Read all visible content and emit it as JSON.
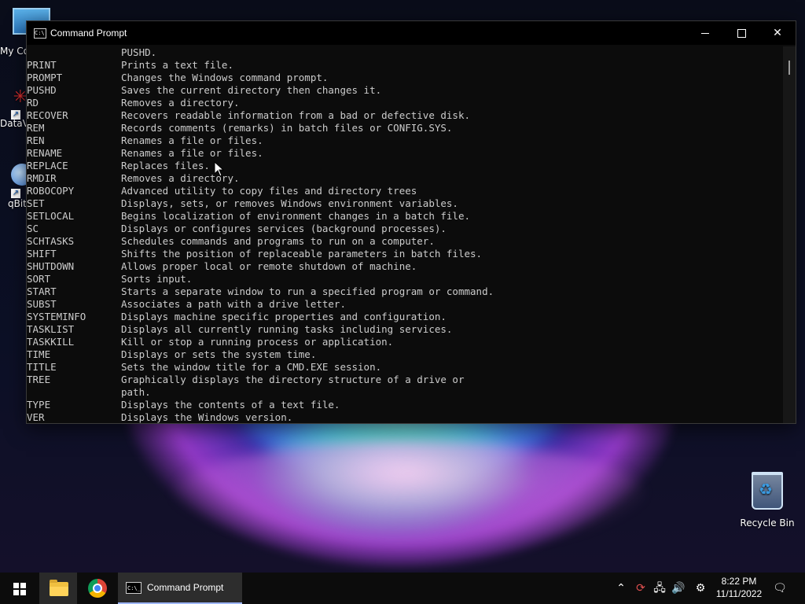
{
  "desktop": {
    "icons": [
      {
        "label": "My Co"
      },
      {
        "label": "DataV"
      },
      {
        "label": "qBitt"
      },
      {
        "label": "Recycle Bin"
      }
    ]
  },
  "window": {
    "title": "Command Prompt",
    "controls": {
      "minimize": "minimize-icon",
      "maximize": "maximize-icon",
      "close": "close-icon"
    }
  },
  "console": {
    "first_line": "PUSHD.",
    "commands": [
      {
        "name": "PRINT",
        "desc": "Prints a text file."
      },
      {
        "name": "PROMPT",
        "desc": "Changes the Windows command prompt."
      },
      {
        "name": "PUSHD",
        "desc": "Saves the current directory then changes it."
      },
      {
        "name": "RD",
        "desc": "Removes a directory."
      },
      {
        "name": "RECOVER",
        "desc": "Recovers readable information from a bad or defective disk."
      },
      {
        "name": "REM",
        "desc": "Records comments (remarks) in batch files or CONFIG.SYS."
      },
      {
        "name": "REN",
        "desc": "Renames a file or files."
      },
      {
        "name": "RENAME",
        "desc": "Renames a file or files."
      },
      {
        "name": "REPLACE",
        "desc": "Replaces files."
      },
      {
        "name": "RMDIR",
        "desc": "Removes a directory."
      },
      {
        "name": "ROBOCOPY",
        "desc": "Advanced utility to copy files and directory trees"
      },
      {
        "name": "SET",
        "desc": "Displays, sets, or removes Windows environment variables."
      },
      {
        "name": "SETLOCAL",
        "desc": "Begins localization of environment changes in a batch file."
      },
      {
        "name": "SC",
        "desc": "Displays or configures services (background processes)."
      },
      {
        "name": "SCHTASKS",
        "desc": "Schedules commands and programs to run on a computer."
      },
      {
        "name": "SHIFT",
        "desc": "Shifts the position of replaceable parameters in batch files."
      },
      {
        "name": "SHUTDOWN",
        "desc": "Allows proper local or remote shutdown of machine."
      },
      {
        "name": "SORT",
        "desc": "Sorts input."
      },
      {
        "name": "START",
        "desc": "Starts a separate window to run a specified program or command."
      },
      {
        "name": "SUBST",
        "desc": "Associates a path with a drive letter."
      },
      {
        "name": "SYSTEMINFO",
        "desc": "Displays machine specific properties and configuration."
      },
      {
        "name": "TASKLIST",
        "desc": "Displays all currently running tasks including services."
      },
      {
        "name": "TASKKILL",
        "desc": "Kill or stop a running process or application."
      },
      {
        "name": "TIME",
        "desc": "Displays or sets the system time."
      },
      {
        "name": "TITLE",
        "desc": "Sets the window title for a CMD.EXE session."
      },
      {
        "name": "TREE",
        "desc": "Graphically displays the directory structure of a drive or"
      },
      {
        "name": "",
        "desc": "path."
      },
      {
        "name": "TYPE",
        "desc": "Displays the contents of a text file."
      },
      {
        "name": "VER",
        "desc": "Displays the Windows version."
      }
    ]
  },
  "taskbar": {
    "apps": [
      {
        "name": "start",
        "icon": "windows-start-icon"
      },
      {
        "name": "file-explorer",
        "icon": "folder-icon"
      },
      {
        "name": "chrome",
        "icon": "chrome-icon"
      },
      {
        "name": "command-prompt",
        "label": "Command Prompt",
        "icon": "cmd-icon"
      }
    ],
    "tray": {
      "chevron": "⌃",
      "sync": "⟳",
      "network": "🖧",
      "volume": "🔊",
      "settings": "⚙",
      "notifications": "🗨"
    },
    "clock": {
      "time": "8:22 PM",
      "date": "11/11/2022"
    }
  },
  "colors": {
    "console_bg": "#0c0c0c",
    "console_text": "#cccccc",
    "taskbar_bg": "#0c0c0c",
    "active_indicator": "#9fb7ff"
  }
}
